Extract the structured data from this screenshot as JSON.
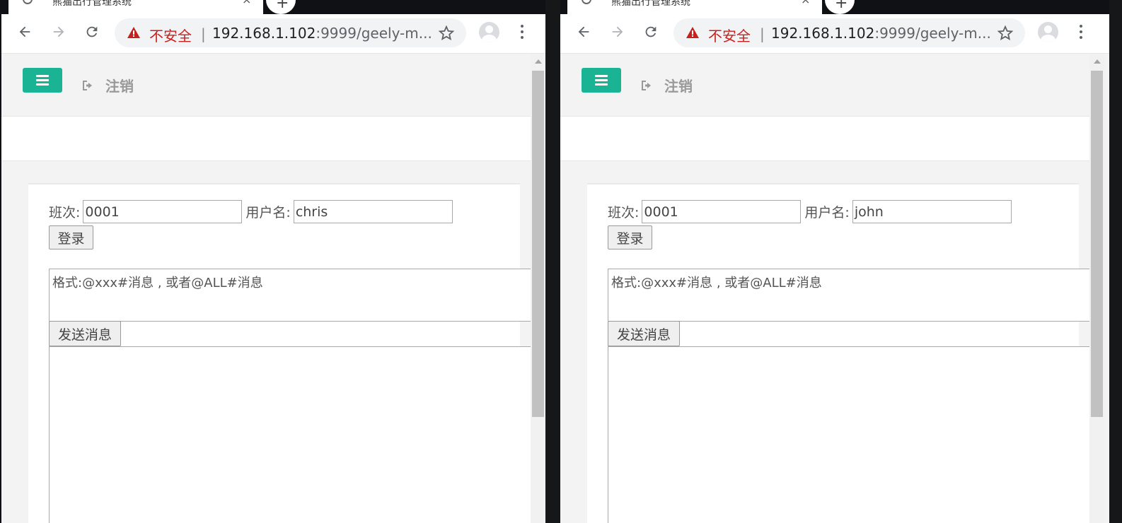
{
  "windows": [
    {
      "tab": {
        "title": "熊猫出行管理系统",
        "close": "×",
        "newtab": "+"
      },
      "address": {
        "insecure_label": "不安全",
        "separator": "|",
        "host": "192.168.1.102",
        "rest": ":9999/geely-m..."
      },
      "header": {
        "logout_label": "注销"
      },
      "form": {
        "class_label": "班次:",
        "class_value": "0001",
        "user_label": "用户名:",
        "user_value": "chris",
        "login_label": "登录",
        "message_placeholder": "格式:@xxx#消息 , 或者@ALL#消息",
        "send_label": "发送消息"
      }
    },
    {
      "tab": {
        "title": "熊猫出行管理系统",
        "close": "×",
        "newtab": "+"
      },
      "address": {
        "insecure_label": "不安全",
        "separator": "|",
        "host": "192.168.1.102",
        "rest": ":9999/geely-m..."
      },
      "header": {
        "logout_label": "注销"
      },
      "form": {
        "class_label": "班次:",
        "class_value": "0001",
        "user_label": "用户名:",
        "user_value": "john",
        "login_label": "登录",
        "message_placeholder": "格式:@xxx#消息 , 或者@ALL#消息",
        "send_label": "发送消息"
      }
    }
  ],
  "colors": {
    "accent": "#1ab394",
    "insecure": "#c5221f"
  }
}
